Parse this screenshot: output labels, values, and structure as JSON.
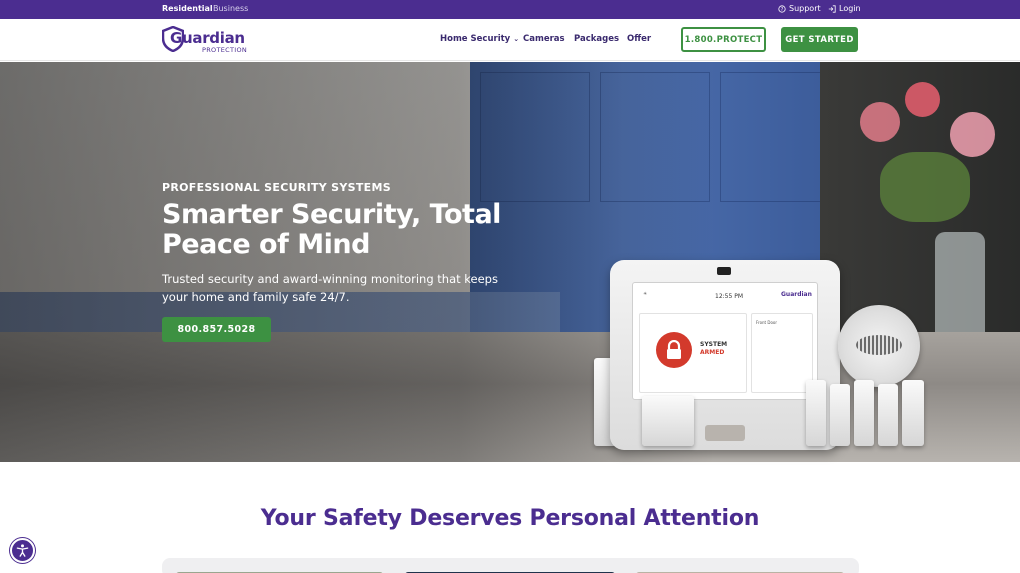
{
  "topbar": {
    "segments": [
      "Residential",
      "Business"
    ],
    "support_label": "Support",
    "login_label": "Login"
  },
  "nav": {
    "logo_text": "Guardian",
    "logo_subtext": "PROTECTION",
    "links": [
      "Home Security",
      "Cameras",
      "Packages",
      "Offer"
    ],
    "phone_button": "1.800.PROTECT",
    "cta_button": "GET STARTED"
  },
  "hero": {
    "eyebrow": "PROFESSIONAL SECURITY SYSTEMS",
    "headline": "Smarter Security, Total Peace of Mind",
    "subtext": "Trusted security and award-winning monitoring that keeps your home and family safe 24/7.",
    "call_button": "800.857.5028"
  },
  "panel_screen": {
    "time": "12:55 PM",
    "status_line1": "SYSTEM",
    "status_line2": "ARMED",
    "logo": "Guardian",
    "side_label": "Front Door"
  },
  "section": {
    "title": "Your Safety Deserves Personal Attention"
  },
  "colors": {
    "brand_purple": "#4b2d90",
    "cta_green": "#3d9142",
    "alert_red": "#d33a2c"
  },
  "icons": [
    "support-icon",
    "login-icon",
    "guardian-shield-logo",
    "chevron-down-icon",
    "lock-icon",
    "accessibility-icon"
  ]
}
